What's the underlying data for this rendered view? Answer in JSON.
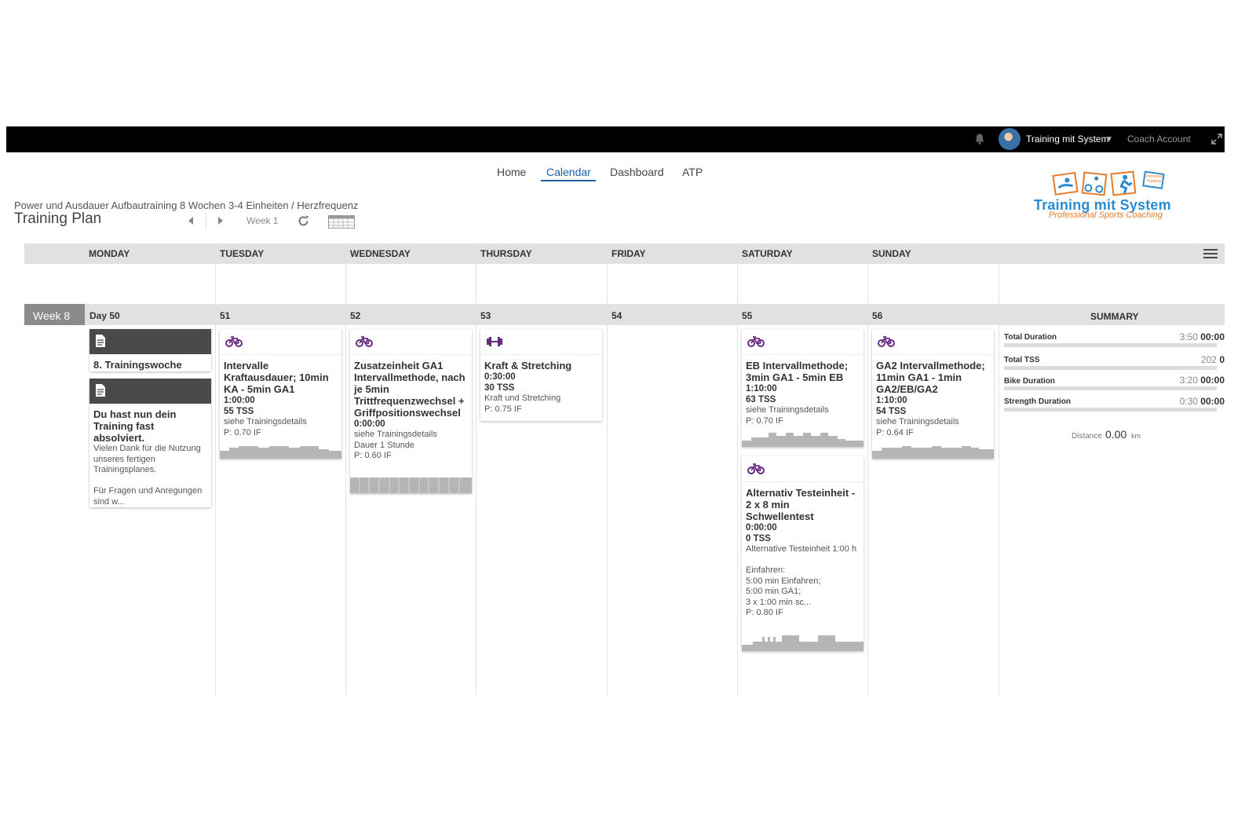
{
  "topbar": {
    "user_name": "Training mit System",
    "caret": "▼",
    "coach_account": "Coach Account"
  },
  "nav": {
    "home": "Home",
    "calendar": "Calendar",
    "dashboard": "Dashboard",
    "atp": "ATP"
  },
  "plan": {
    "subtitle": "Power und Ausdauer Aufbautraining 8 Wochen 3-4 Einheiten / Herzfrequenz",
    "title": "Training Plan",
    "week": "Week 1"
  },
  "logo": {
    "text": "Training mit System",
    "sub": "Professional Sports Coaching",
    "badge": "Personal Training"
  },
  "days": [
    "MONDAY",
    "TUESDAY",
    "WEDNESDAY",
    "THURSDAY",
    "FRIDAY",
    "SATURDAY",
    "SUNDAY"
  ],
  "week": {
    "label": "Week 8",
    "day_numbers": [
      "Day 50",
      "51",
      "52",
      "53",
      "54",
      "55",
      "56"
    ]
  },
  "summary": {
    "title": "SUMMARY",
    "rows": [
      {
        "label": "Total Duration",
        "value": "3:50",
        "bold": "00:00"
      },
      {
        "label": "Total TSS",
        "value": "202",
        "bold": "0"
      },
      {
        "label": "Bike Duration",
        "value": "3:20",
        "bold": "00:00"
      },
      {
        "label": "Strength Duration",
        "value": "0:30",
        "bold": "00:00"
      }
    ],
    "distance_label": "Distance",
    "distance_value": "0.00",
    "distance_unit": "km"
  },
  "cards": {
    "mon1": {
      "title": "8. Trainingswoche"
    },
    "mon2": {
      "title": "Du hast nun dein Training fast absolviert.",
      "text": "Vielen Dank für die Nutzung unseres fertigen Trainingsplanes.\n\nFür Fragen und Anregungen sind w..."
    },
    "tue": {
      "title": "Intervalle Kraftausdauer;  10min KA - 5min GA1",
      "duration": "1:00:00",
      "tss": "55 TSS",
      "text": "siehe Trainingsdetails\nP: 0.70 IF"
    },
    "wed": {
      "title": "Zusatzeinheit   GA1 Intervallmethode, nach je 5min Trittfrequenzwechsel + Griffpositionswechsel",
      "duration": "0:00:00",
      "text": "siehe Trainingsdetails\nDauer 1 Stunde\nP: 0.60 IF"
    },
    "thu": {
      "title": "Kraft & Stretching",
      "duration": "0:30:00",
      "tss": "30 TSS",
      "text": "Kraft und Stretching\nP: 0.75 IF"
    },
    "sat1": {
      "title": "EB Intervallmethode; 3min GA1 - 5min EB",
      "duration": "1:10:00",
      "tss": "63 TSS",
      "text": "siehe Trainingsdetails\nP: 0.70 IF"
    },
    "sat2": {
      "title": "Alternativ Testeinheit - 2 x 8 min Schwellentest",
      "duration": "0:00:00",
      "tss": "0 TSS",
      "text": "Alternative Testeinheit 1:00 h\n\nEinfahren:\n5:00 min Einfahren;\n5:00 min GA1;\n3 x 1:00 min sc...\nP: 0.80 IF"
    },
    "sun": {
      "title": "GA2 Intervallmethode; 11min GA1 - 1min GA2/EB/GA2",
      "duration": "1:10:00",
      "tss": "54 TSS",
      "text": "siehe Trainingsdetails\nP: 0.64 IF"
    }
  },
  "colors": {
    "accent": "#1d5fa8",
    "workout_icon": "#6b2a82",
    "header_gray": "#e1e1e1",
    "week_badge": "#8a8a8a",
    "logo_blue": "#2b8bd0",
    "logo_orange": "#e57c2c"
  },
  "icons": {
    "bell": "bell-icon",
    "expand": "expand-icon",
    "menu": "hamburger-menu-icon",
    "bike": "bike-icon",
    "strength": "dumbbell-icon",
    "note": "document-icon",
    "refresh": "refresh-icon",
    "calendar": "calendar-icon"
  }
}
